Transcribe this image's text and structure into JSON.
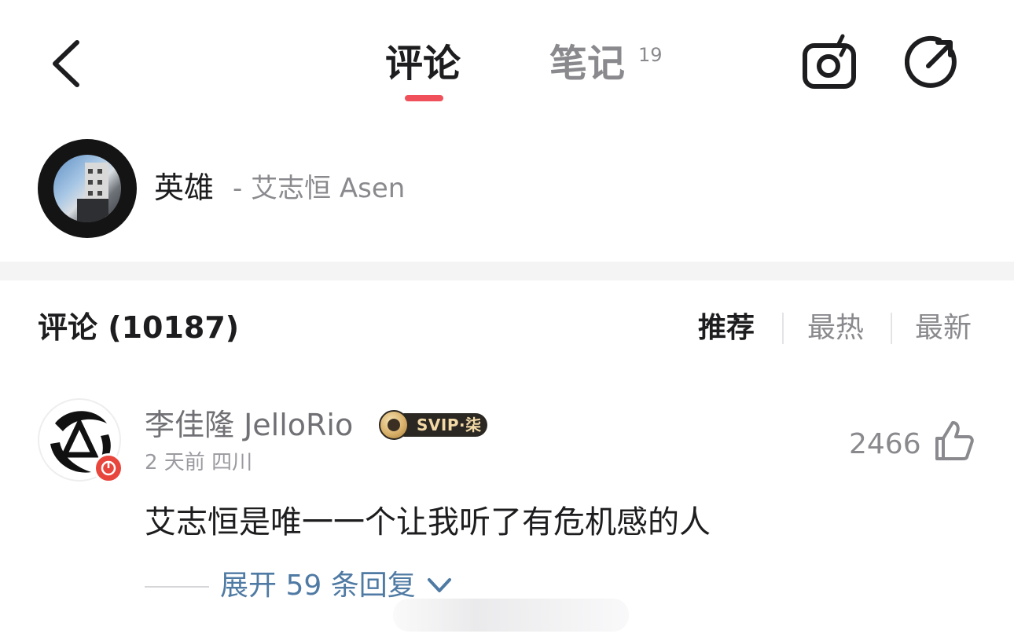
{
  "nav": {
    "tab_comments": "评论",
    "tab_notes": "笔记",
    "notes_count": "19",
    "accent_color": "#f0505a"
  },
  "song": {
    "title": "英雄",
    "artist": "- 艾志恒 Asen"
  },
  "comments_header": {
    "title": "评论 (10187)",
    "sort_options": [
      "推荐",
      "最热",
      "最新"
    ],
    "active_sort": "推荐"
  },
  "comment": {
    "username": "李佳隆 JelloRio",
    "badge": "SVIP·柒",
    "meta": "2 天前 四川",
    "likes": "2466",
    "text": "艾志恒是唯一一个让我听了有危机感的人",
    "expand_replies": "展开 59 条回复"
  },
  "icons": {
    "back": "back-chevron-icon",
    "camera": "camera-icon",
    "share": "share-icon",
    "like": "thumbs-up-icon",
    "expand": "chevron-down-icon"
  }
}
